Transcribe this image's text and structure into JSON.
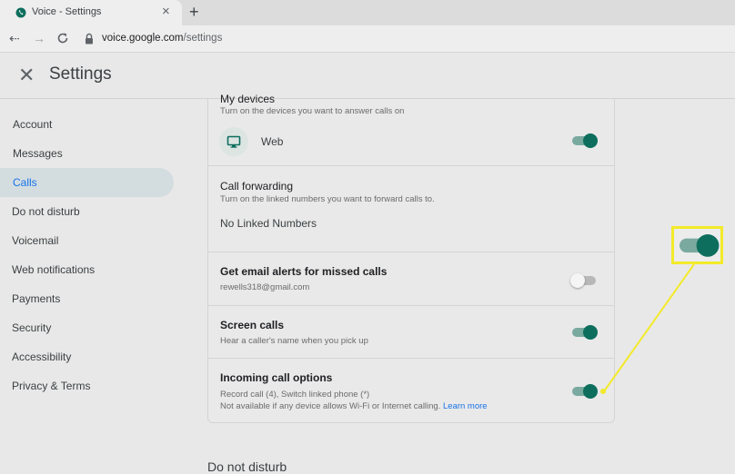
{
  "browser": {
    "tab_title": "Voice - Settings",
    "tab_close": "×",
    "new_tab": "+",
    "back": "⇠",
    "forward": "→",
    "url_host": "voice.google.com",
    "url_path": "/settings"
  },
  "header": {
    "close": "✕",
    "title": "Settings"
  },
  "sidebar": {
    "items": [
      {
        "label": "Account"
      },
      {
        "label": "Messages"
      },
      {
        "label": "Calls",
        "active": true
      },
      {
        "label": "Do not disturb"
      },
      {
        "label": "Voicemail"
      },
      {
        "label": "Web notifications"
      },
      {
        "label": "Payments"
      },
      {
        "label": "Security"
      },
      {
        "label": "Accessibility"
      },
      {
        "label": "Privacy & Terms"
      }
    ]
  },
  "calls": {
    "my_devices": {
      "title": "My devices",
      "subtitle": "Turn on the devices you want to answer calls on",
      "device_label": "Web",
      "device_icon": "monitor-icon",
      "enabled": true
    },
    "call_forwarding": {
      "title": "Call forwarding",
      "subtitle": "Turn on the linked numbers you want to forward calls to.",
      "empty": "No Linked Numbers"
    },
    "email_alerts": {
      "title": "Get email alerts for missed calls",
      "email": "rewells318@gmail.com",
      "enabled": false
    },
    "screen_calls": {
      "title": "Screen calls",
      "subtitle": "Hear a caller's name when you pick up",
      "enabled": true
    },
    "incoming_options": {
      "title": "Incoming call options",
      "line1": "Record call (4), Switch linked phone (*)",
      "line2": "Not available if any device allows Wi-Fi or Internet calling.",
      "link": "Learn more",
      "enabled": true
    }
  },
  "next_section": "Do not disturb",
  "colors": {
    "accent": "#0d6e5d",
    "link": "#1a73e8",
    "callout": "#f3ea2a"
  }
}
